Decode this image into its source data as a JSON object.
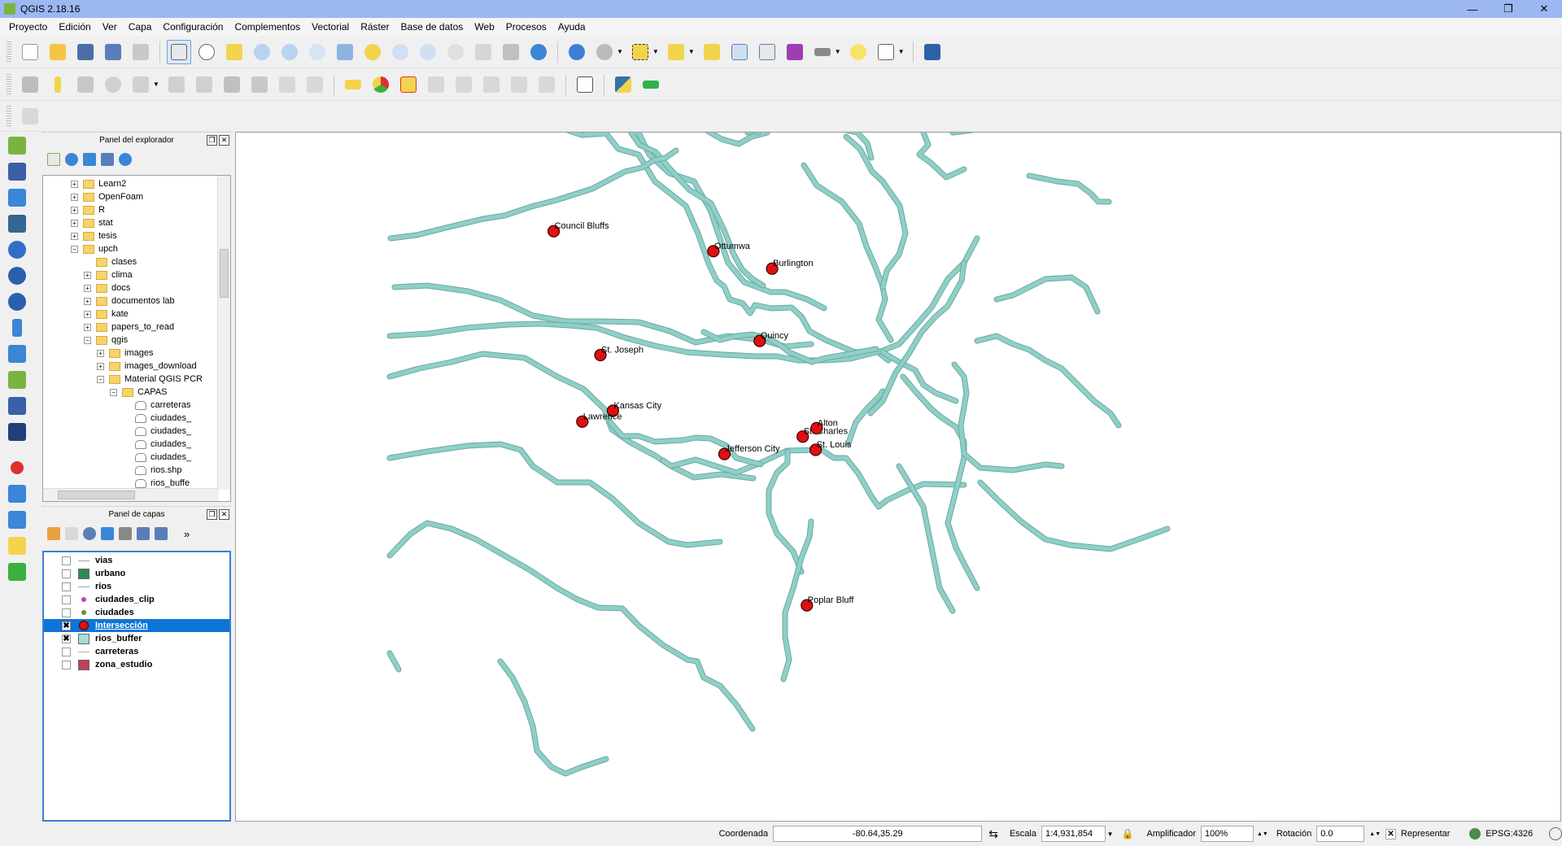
{
  "window": {
    "title": "QGIS 2.18.16",
    "min": "—",
    "max": "❐",
    "close": "✕"
  },
  "menu": [
    "Proyecto",
    "Edición",
    "Ver",
    "Capa",
    "Configuración",
    "Complementos",
    "Vectorial",
    "Ráster",
    "Base de datos",
    "Web",
    "Procesos",
    "Ayuda"
  ],
  "browser_panel": {
    "title": "Panel del explorador",
    "items": [
      {
        "label": "Learn2",
        "depth": 0,
        "type": "folder",
        "expander": "+"
      },
      {
        "label": "OpenFoam",
        "depth": 0,
        "type": "folder",
        "expander": "+"
      },
      {
        "label": "R",
        "depth": 0,
        "type": "folder",
        "expander": "+"
      },
      {
        "label": "stat",
        "depth": 0,
        "type": "folder",
        "expander": "+"
      },
      {
        "label": "tesis",
        "depth": 0,
        "type": "folder",
        "expander": "+"
      },
      {
        "label": "upch",
        "depth": 0,
        "type": "folder",
        "expander": "−"
      },
      {
        "label": "clases",
        "depth": 1,
        "type": "folder",
        "expander": ""
      },
      {
        "label": "clima",
        "depth": 1,
        "type": "folder",
        "expander": "+"
      },
      {
        "label": "docs",
        "depth": 1,
        "type": "folder",
        "expander": "+"
      },
      {
        "label": "documentos lab",
        "depth": 1,
        "type": "folder",
        "expander": "+"
      },
      {
        "label": "kate",
        "depth": 1,
        "type": "folder",
        "expander": "+"
      },
      {
        "label": "papers_to_read",
        "depth": 1,
        "type": "folder",
        "expander": "+"
      },
      {
        "label": "qgis",
        "depth": 1,
        "type": "folder",
        "expander": "−"
      },
      {
        "label": "images",
        "depth": 2,
        "type": "folder",
        "expander": "+"
      },
      {
        "label": "images_download",
        "depth": 2,
        "type": "folder",
        "expander": "+"
      },
      {
        "label": "Material QGIS PCR",
        "depth": 2,
        "type": "folder",
        "expander": "−"
      },
      {
        "label": "CAPAS",
        "depth": 3,
        "type": "folder",
        "expander": "−"
      },
      {
        "label": "carreteras",
        "depth": 4,
        "type": "file",
        "expander": ""
      },
      {
        "label": "ciudades_",
        "depth": 4,
        "type": "file",
        "expander": ""
      },
      {
        "label": "ciudades_",
        "depth": 4,
        "type": "file",
        "expander": ""
      },
      {
        "label": "ciudades_",
        "depth": 4,
        "type": "file",
        "expander": ""
      },
      {
        "label": "ciudades_",
        "depth": 4,
        "type": "file",
        "expander": ""
      },
      {
        "label": "rios.shp",
        "depth": 4,
        "type": "file",
        "expander": ""
      },
      {
        "label": "rios_buffe",
        "depth": 4,
        "type": "file",
        "expander": ""
      }
    ]
  },
  "layers_panel": {
    "title": "Panel de capas",
    "more": "»",
    "layers": [
      {
        "name": "vias",
        "checked": false,
        "symbol": "line",
        "color": "#9aa8b4",
        "selected": false
      },
      {
        "name": "urbano",
        "checked": false,
        "symbol": "fill",
        "color": "#2e8b57",
        "selected": false
      },
      {
        "name": "rios",
        "checked": false,
        "symbol": "line",
        "color": "#9aa8b4",
        "selected": false
      },
      {
        "name": "ciudades_clip",
        "checked": false,
        "symbol": "point",
        "color": "#c040c0",
        "selected": false
      },
      {
        "name": "ciudades",
        "checked": false,
        "symbol": "point",
        "color": "#6a8a3a",
        "selected": false
      },
      {
        "name": "Intersección",
        "checked": true,
        "symbol": "point-big",
        "color": "#e01010",
        "selected": true
      },
      {
        "name": "rios_buffer",
        "checked": true,
        "symbol": "fill",
        "color": "#a8dcd6",
        "selected": false
      },
      {
        "name": "carreteras",
        "checked": false,
        "symbol": "line",
        "color": "#d9a0a0",
        "selected": false
      },
      {
        "name": "zona_estudio",
        "checked": false,
        "symbol": "fill",
        "color": "#c0405a",
        "selected": false
      }
    ]
  },
  "map": {
    "river_color": "#8fcfc8",
    "river_outline": "#6aaaa2",
    "city_color": "#e01010",
    "cities": [
      {
        "name": "Council Bluffs",
        "lon": -95.86,
        "lat": 41.26
      },
      {
        "name": "Ottumwa",
        "lon": -92.41,
        "lat": 41.02
      },
      {
        "name": "Burlington",
        "lon": -91.14,
        "lat": 40.81
      },
      {
        "name": "St. Joseph",
        "lon": -94.85,
        "lat": 39.77
      },
      {
        "name": "Quincy",
        "lon": -91.41,
        "lat": 39.94
      },
      {
        "name": "Kansas City",
        "lon": -94.58,
        "lat": 39.1
      },
      {
        "name": "Lawrence",
        "lon": -95.24,
        "lat": 38.97
      },
      {
        "name": "Jefferson City",
        "lon": -92.17,
        "lat": 38.58
      },
      {
        "name": "St. Charles",
        "lon": -90.48,
        "lat": 38.79
      },
      {
        "name": "Alton",
        "lon": -90.18,
        "lat": 38.89
      },
      {
        "name": "St. Louis",
        "lon": -90.2,
        "lat": 38.63
      },
      {
        "name": "Poplar Bluff",
        "lon": -90.39,
        "lat": 36.76
      }
    ]
  },
  "status": {
    "coord_label": "Coordenada",
    "coord_value": "-80.64,35.29",
    "scale_label": "Escala",
    "scale_value": "1:4,931,854",
    "magnifier_label": "Amplificador",
    "magnifier_value": "100%",
    "rotation_label": "Rotación",
    "rotation_value": "0.0",
    "render_label": "Representar",
    "crs": "EPSG:4326"
  }
}
